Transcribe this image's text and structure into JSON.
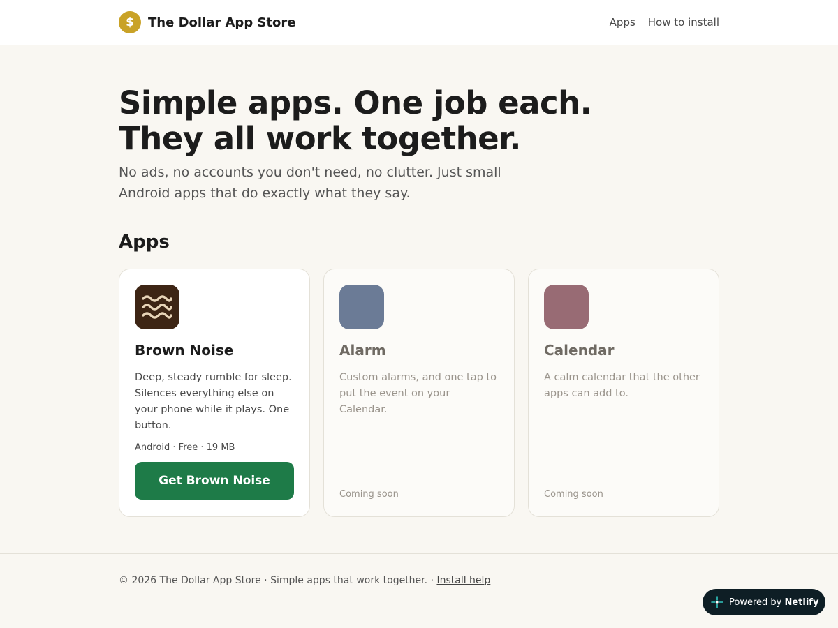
{
  "header": {
    "logo_glyph": "$",
    "brand": "The Dollar App Store",
    "nav": [
      {
        "label": "Apps"
      },
      {
        "label": "How to install"
      }
    ]
  },
  "hero": {
    "title_line1": "Simple apps. One job each.",
    "title_line2": "They all work together.",
    "subtitle": "No ads, no accounts you don't need, no clutter. Just small Android apps that do exactly what they say."
  },
  "apps_heading": "Apps",
  "apps": [
    {
      "name": "Brown Noise",
      "description": "Deep, steady rumble for sleep. Silences everything else on your phone while it plays. One button.",
      "meta": "Android · Free · 19 MB",
      "button_label": "Get Brown Noise",
      "icon": "wave-icon",
      "icon_color": "#3d2514",
      "icon_wave_color": "#e8d5b8"
    },
    {
      "name": "Alarm",
      "description": "Custom alarms, and one tap to put the event on your Calendar.",
      "status": "Coming soon",
      "icon_color": "#6b7b96"
    },
    {
      "name": "Calendar",
      "description": "A calm calendar that the other apps can add to.",
      "status": "Coming soon",
      "icon_color": "#986b74"
    }
  ],
  "footer": {
    "text": "© 2026 The Dollar App Store · Simple apps that work together. · ",
    "link": "Install help"
  },
  "badge": {
    "prefix": "Powered by ",
    "brand": "Netlify",
    "icon": "netlify-icon",
    "icon_color": "#32c5c0"
  },
  "colors": {
    "background": "#f9f7f2",
    "primary_button": "#1e7b48",
    "logo": "#c9a227"
  }
}
